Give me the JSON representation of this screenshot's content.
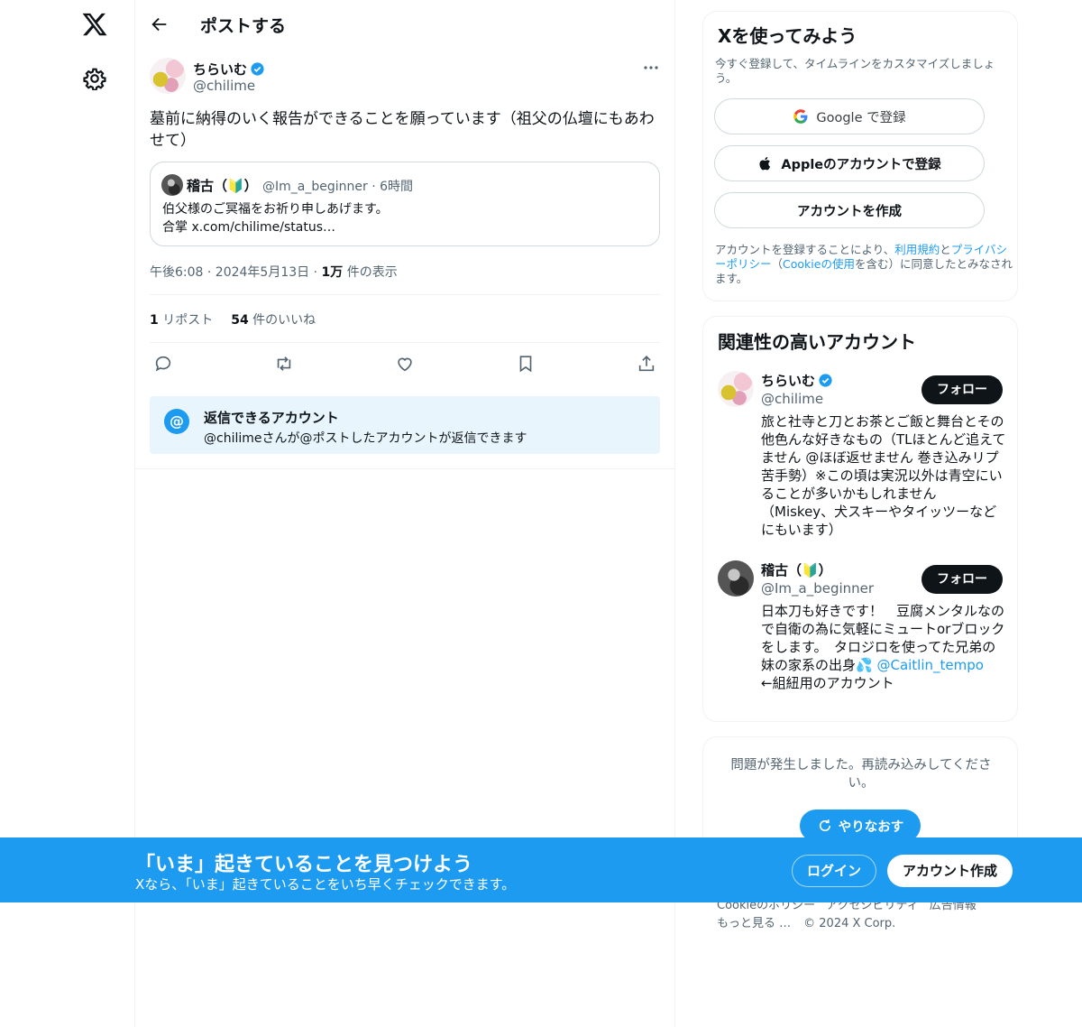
{
  "header": {
    "title": "ポストする"
  },
  "post": {
    "author_name": "ちらいむ",
    "author_handle": "@chilime",
    "text": "墓前に納得のいく報告ができることを願っています（祖父の仏壇にもあわせて）",
    "quote": {
      "author_name": "稽古（🔰）",
      "author_handle": "@Im_a_beginner · 6時間",
      "line1": "伯父様のご冥福をお祈り申しあげます。",
      "line2": "合掌 x.com/chilime/status…"
    },
    "meta": {
      "time": "午後6:08 · 2024年5月13日 · ",
      "views_count": "1万",
      "views_label": " 件の表示"
    },
    "stats": {
      "reposts_count": "1",
      "reposts_label": " リポスト",
      "likes_count": "54",
      "likes_label": " 件のいいね"
    },
    "reply_box": {
      "at_symbol": "@",
      "title": "返信できるアカウント",
      "description": "@chilimeさんが@ポストしたアカウントが返信できます"
    }
  },
  "signup": {
    "title": "Xを使ってみよう",
    "subtitle": "今すぐ登録して、タイムラインをカスタマイズしましょう。",
    "google_label": "Google で登録",
    "apple_label": "Appleのアカウントで登録",
    "create_label": "アカウントを作成",
    "legal": {
      "prefix": "アカウントを登録することにより、",
      "terms": "利用規約",
      "and": "と",
      "privacy": "プライバシーポリシー",
      "paren_open": "（",
      "cookie": "Cookieの使用",
      "suffix": "を含む）に同意したとみなされます。"
    }
  },
  "relevant": {
    "title": "関連性の高いアカウント",
    "accounts": [
      {
        "name": "ちらいむ",
        "handle": "@chilime",
        "follow_label": "フォロー",
        "bio": "旅と社寺と刀とお茶とご飯と舞台とその他色んな好きなもの（TLほとんど追えてません @ほぼ返せません 巻き込みリプ苦手勢）※この頃は実況以外は青空にいることが多いかもしれません（Miskey、犬スキーやタイッツーなどにもいます）"
      },
      {
        "name": "稽古（🔰）",
        "handle": "@Im_a_beginner",
        "follow_label": "フォロー",
        "bio": "日本刀も好きです！　豆腐メンタルなので自衛の為に気軽にミュートorブロックをします。　タロジロを使ってた兄弟の妹の家系の出身💦",
        "mention": "@Caitlin_tempo",
        "bio_after": "　←組紐用のアカウント"
      }
    ]
  },
  "error_card": {
    "message": "問題が発生しました。再読み込みしてください。",
    "retry_label": "やりなおす"
  },
  "footer": {
    "links": [
      "Cookieのポリシー",
      "アクセシビリティ",
      "広告情報"
    ],
    "more": "もっと見る …",
    "copyright": "© 2024 X Corp."
  },
  "banner": {
    "title": "「いま」起きていることを見つけよう",
    "subtitle": "Xなら、「いま」起きていることをいち早くチェックできます。",
    "login_label": "ログイン",
    "create_label": "アカウント作成"
  },
  "colors": {
    "accent": "#1d9bf0",
    "text": "#0f1419",
    "secondary": "#536471",
    "border": "#eff3f4"
  },
  "icons": [
    "x-logo-icon",
    "gear-icon",
    "back-arrow-icon",
    "verified-icon",
    "more-icon",
    "reply-icon",
    "repost-icon",
    "like-icon",
    "bookmark-icon",
    "share-icon",
    "google-icon",
    "apple-icon",
    "refresh-icon"
  ]
}
